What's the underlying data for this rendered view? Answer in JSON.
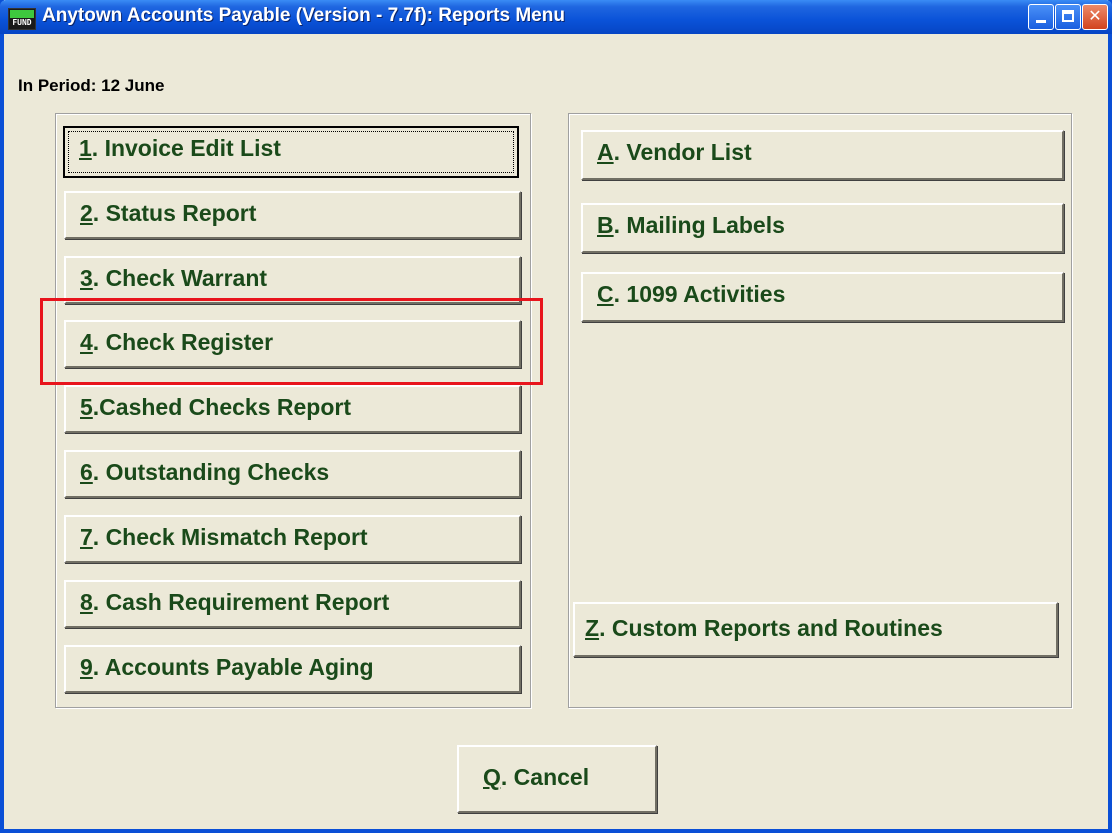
{
  "window": {
    "title": "Anytown Accounts Payable (Version - 7.7f):  Reports Menu",
    "icon_label": "FUND",
    "minimize_icon": "minimize-icon",
    "maximize_icon": "maximize-icon",
    "close_icon": "close-icon"
  },
  "period_label": "In Period: 12 June",
  "left_buttons": [
    {
      "key": "1",
      "text": ".  Invoice Edit List"
    },
    {
      "key": "2",
      "text": ". Status Report"
    },
    {
      "key": "3",
      "text": ". Check Warrant"
    },
    {
      "key": "4",
      "text": ". Check Register"
    },
    {
      "key": "5",
      "text": ".Cashed Checks Report"
    },
    {
      "key": "6",
      "text": ". Outstanding Checks"
    },
    {
      "key": "7",
      "text": ". Check Mismatch Report"
    },
    {
      "key": "8",
      "text": ". Cash Requirement Report"
    },
    {
      "key": "9",
      "text": ".  Accounts Payable Aging"
    }
  ],
  "right_buttons": [
    {
      "key": "A",
      "text": ". Vendor List"
    },
    {
      "key": "B",
      "text": ". Mailing Labels"
    },
    {
      "key": "C",
      "text": ".  1099 Activities"
    },
    {
      "key": "Z",
      "text": ".  Custom Reports and Routines"
    }
  ],
  "cancel_button": {
    "key": "Q",
    "text": ". Cancel"
  },
  "colors": {
    "highlight": "#e8141c",
    "titlebar": "#0a52d8",
    "button_text": "#1a4a1a"
  }
}
